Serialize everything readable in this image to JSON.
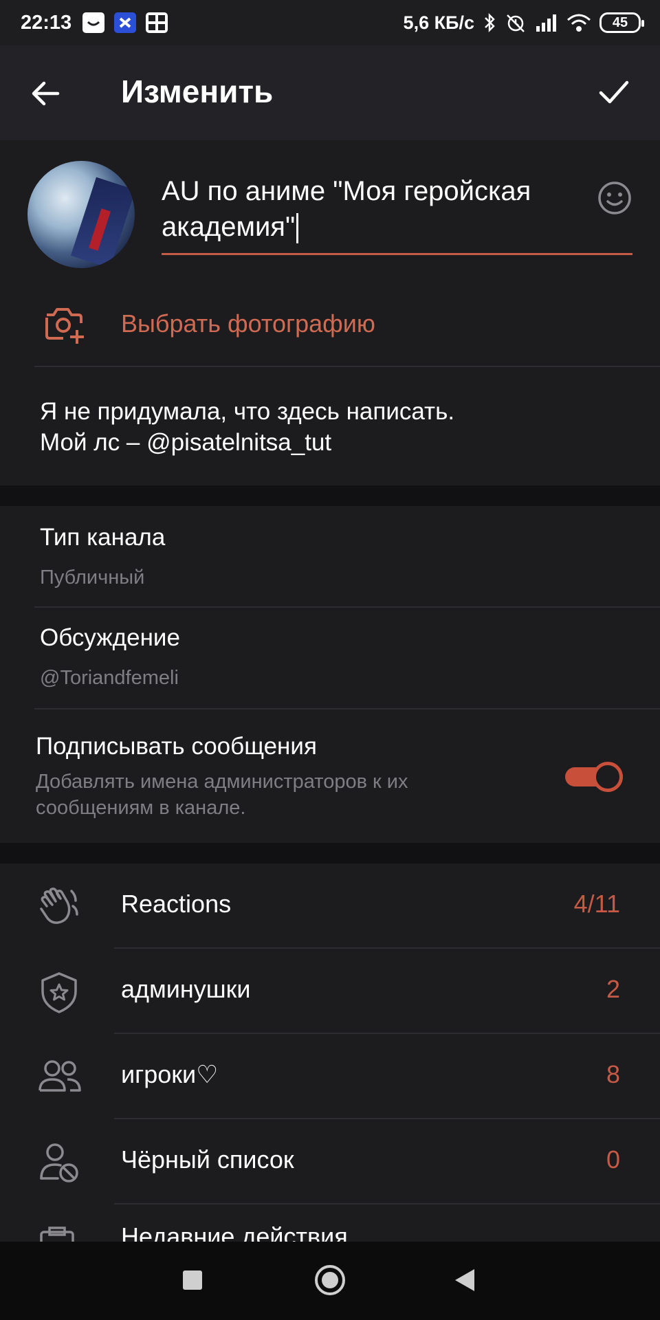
{
  "status_bar": {
    "time": "22:13",
    "speed": "5,6 КБ/с",
    "battery": "45",
    "icons": [
      "vk-app-icon",
      "messenger-app-icon",
      "gallery-app-icon",
      "bluetooth-icon",
      "alarm-off-icon",
      "signal-icon",
      "wifi-icon"
    ]
  },
  "header": {
    "title": "Изменить"
  },
  "channel": {
    "name": "AU по аниме \"Моя геройская академия\"",
    "choose_photo_label": "Выбрать фотографию",
    "description_line1": "Я не придумала, что здесь написать.",
    "description_line2": "Мой лс – @pisatelnitsa_tut"
  },
  "settings": {
    "channel_type_title": "Тип канала",
    "channel_type_value": "Публичный",
    "discussion_title": "Обсуждение",
    "discussion_value": "@Toriandfemeli",
    "sign_messages_title": "Подписывать сообщения",
    "sign_messages_desc": "Добавлять имена администраторов к их сообщениям в канале.",
    "sign_messages_on": true
  },
  "list": {
    "items": [
      {
        "label": "Reactions",
        "count": "4/11",
        "icon": "reactions-hand-icon"
      },
      {
        "label": "админушки",
        "count": "2",
        "icon": "admin-shield-icon"
      },
      {
        "label": "игроки♡",
        "count": "8",
        "icon": "members-icon"
      },
      {
        "label": "Чёрный список",
        "count": "0",
        "icon": "blocked-user-icon"
      }
    ],
    "partial_label": "Недавние действия"
  },
  "colors": {
    "accent": "#c55a46",
    "background": "#1c1b1e",
    "header": "#232226",
    "divider": "#2d2c30",
    "muted": "#7f7e83"
  }
}
